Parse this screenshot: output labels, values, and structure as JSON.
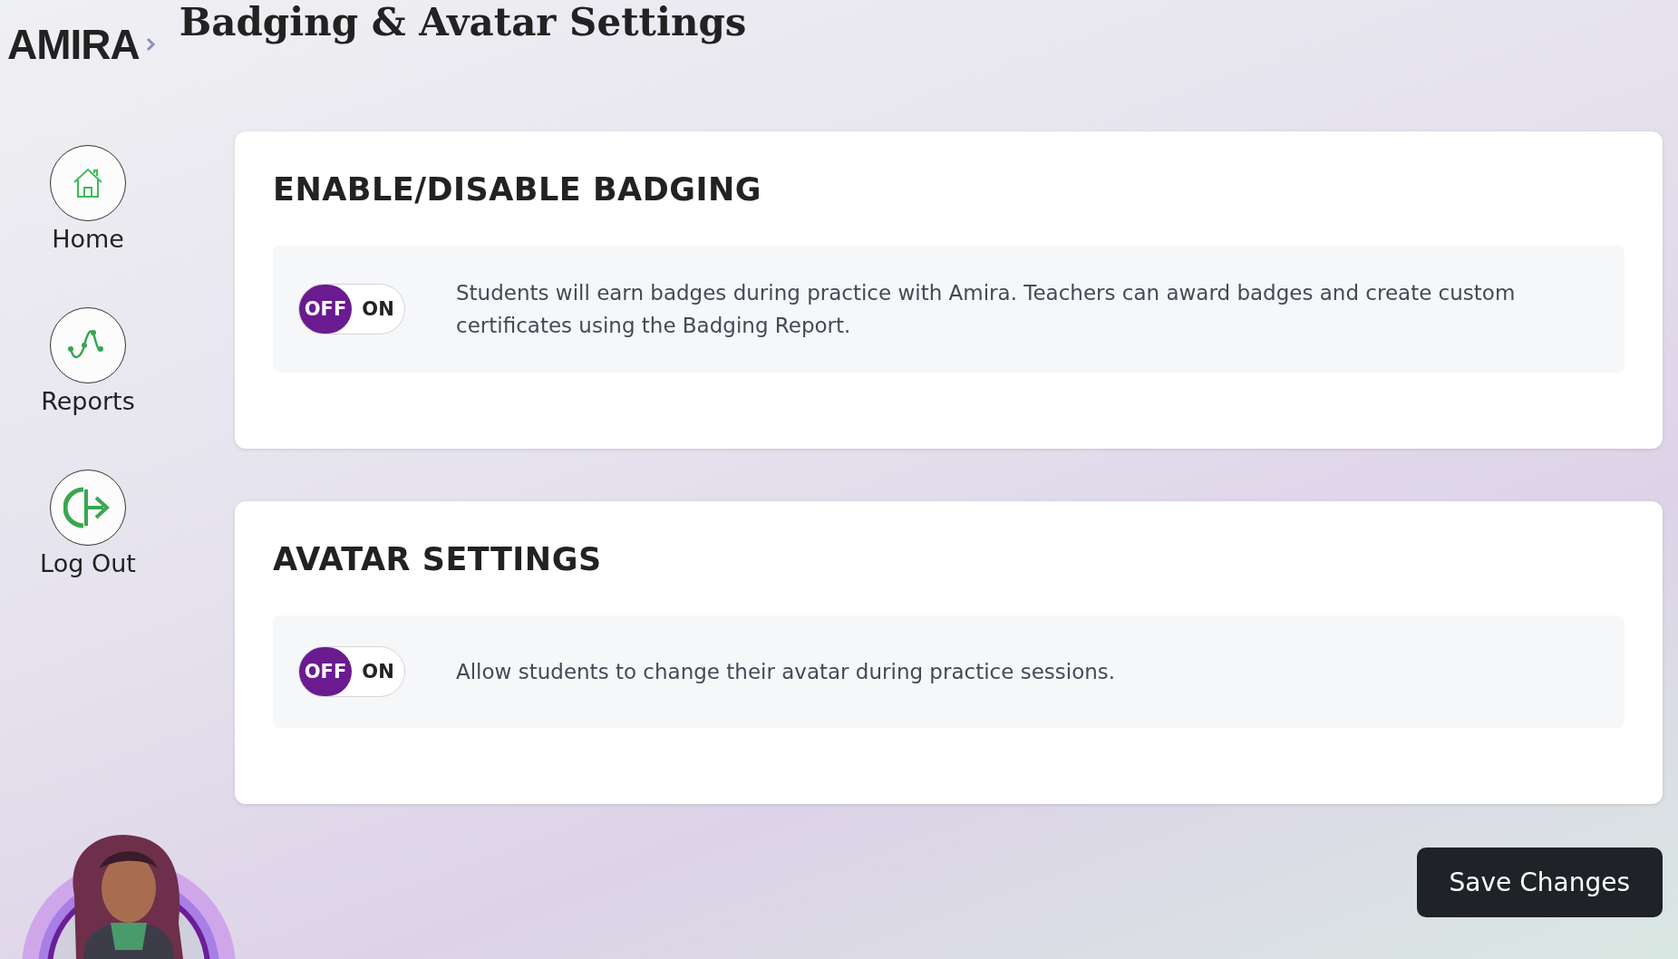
{
  "header": {
    "logo": "AMIRA",
    "title": "Badging & Avatar Settings"
  },
  "sidebar": {
    "items": [
      {
        "kind": "home",
        "label": "Home"
      },
      {
        "kind": "reports",
        "label": "Reports"
      },
      {
        "kind": "logout",
        "label": "Log Out"
      }
    ]
  },
  "sections": [
    {
      "title": "ENABLE/DISABLE BADGING",
      "toggle": [
        {
          "label": "OFF",
          "selected": true
        },
        {
          "label": "ON",
          "selected": false
        }
      ],
      "description": "Students will earn badges during practice with Amira. Teachers can award badges and create custom certificates using the Badging Report."
    },
    {
      "title": "AVATAR SETTINGS",
      "toggle": [
        {
          "label": "OFF",
          "selected": true
        },
        {
          "label": "ON",
          "selected": false
        }
      ],
      "description": "Allow students to change their avatar during practice sessions."
    }
  ],
  "save_button": "Save Changes"
}
